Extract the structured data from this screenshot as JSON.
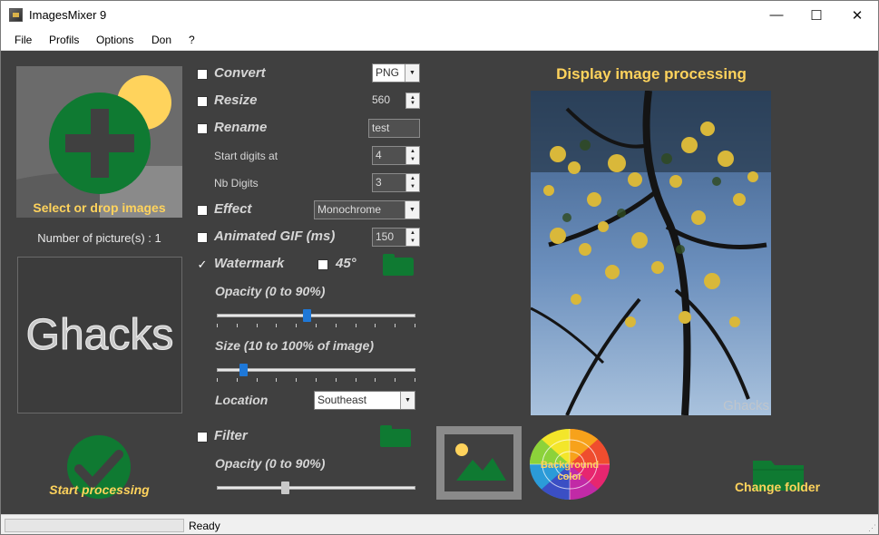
{
  "window": {
    "title": "ImagesMixer 9",
    "minimize": "—",
    "maximize": "☐",
    "close": "✕"
  },
  "menu": [
    "File",
    "Profils",
    "Options",
    "Don",
    "?"
  ],
  "left": {
    "select_label": "Select or drop images",
    "picture_count": "Number of picture(s) : 1",
    "watermark_preview_text": "Ghacks",
    "start_label": "Start processing"
  },
  "options": {
    "convert": {
      "label": "Convert",
      "value": "PNG",
      "checked": false
    },
    "resize": {
      "label": "Resize",
      "value": "560",
      "checked": false
    },
    "rename": {
      "label": "Rename",
      "value": "test",
      "checked": false
    },
    "start_digits": {
      "label": "Start digits at",
      "value": "4"
    },
    "nb_digits": {
      "label": "Nb Digits",
      "value": "3"
    },
    "effect": {
      "label": "Effect",
      "value": "Monochrome",
      "checked": false
    },
    "animated_gif": {
      "label": "Animated GIF (ms)",
      "value": "150",
      "checked": false
    },
    "watermark": {
      "label": "Watermark",
      "checked": true,
      "check_glyph": "✓"
    },
    "angle": {
      "label": "45°",
      "checked": false
    },
    "opacity": {
      "label": "Opacity (0 to 90%)",
      "value_fraction": 0.45
    },
    "size": {
      "label": "Size (10 to 100% of image)",
      "value_fraction": 0.12
    },
    "location": {
      "label": "Location",
      "value": "Southeast"
    },
    "filter": {
      "label": "Filter",
      "checked": false
    },
    "filter_opacity": {
      "label": "Opacity (0 to 90%)",
      "value_fraction": 0.34
    }
  },
  "right": {
    "display_title": "Display image processing",
    "preview_watermark": "Ghacks",
    "background_color_label_1": "Background",
    "background_color_label_2": "color",
    "change_folder_label": "Change folder"
  },
  "status": {
    "text": "Ready"
  },
  "colors": {
    "accent_yellow": "#ffd35c",
    "icon_green": "#0f7a32",
    "background": "#404040",
    "slider_thumb": "#1e78d8"
  }
}
